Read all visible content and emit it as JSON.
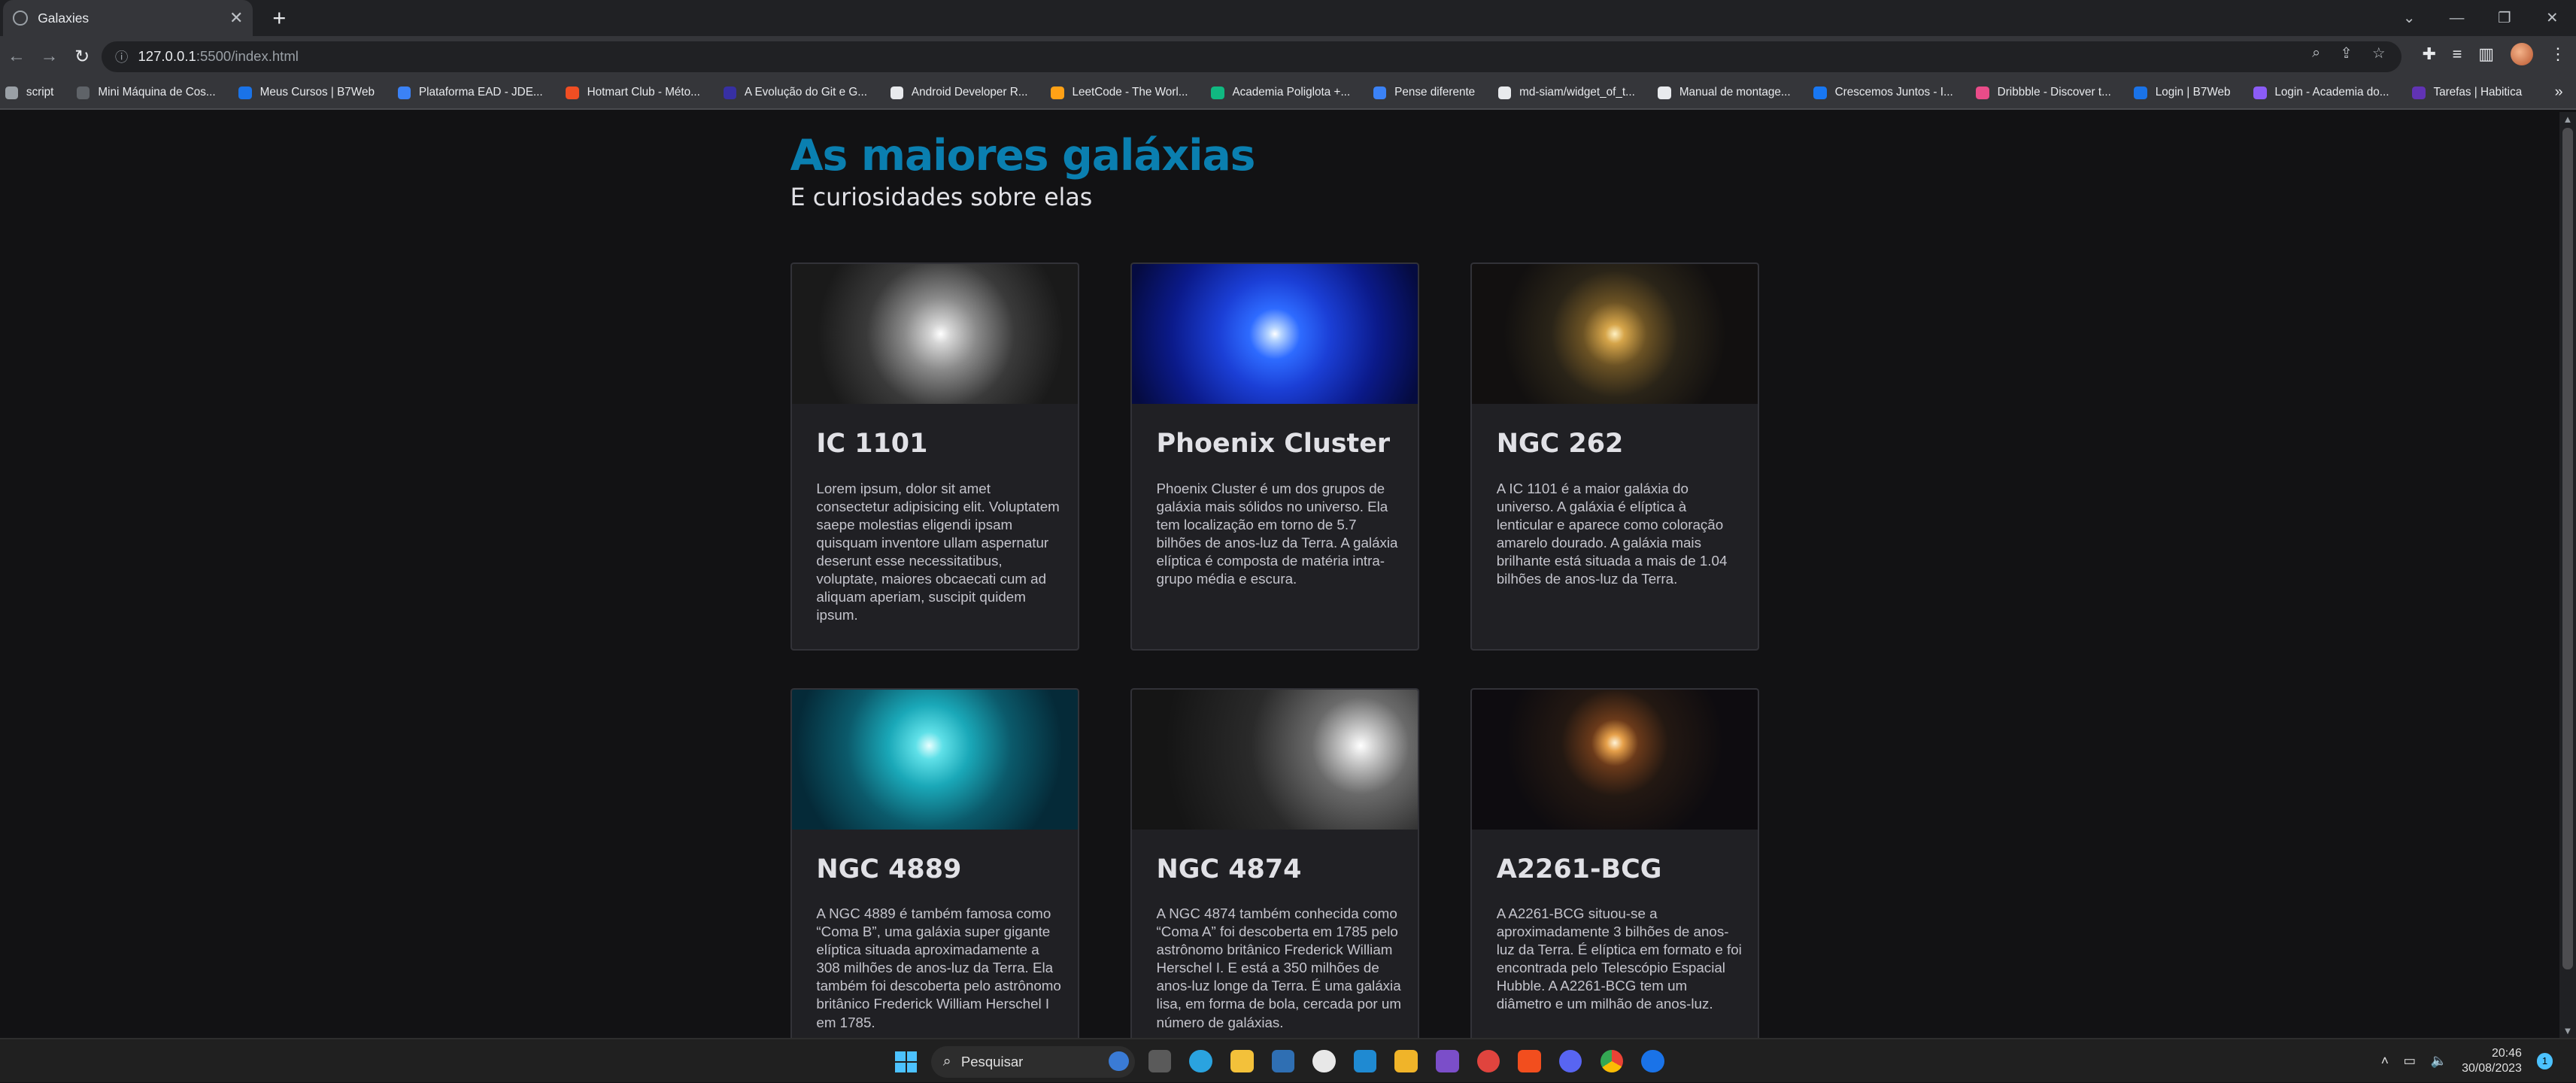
{
  "browser": {
    "tab_title": "Galaxies",
    "new_tab_symbol": "+",
    "url_host": "127.0.0.1",
    "url_path": ":5500/index.html",
    "bookmarks": [
      {
        "label": "script",
        "color": "#9aa0a6"
      },
      {
        "label": "Mini Máquina de Cos...",
        "color": "#5f6368"
      },
      {
        "label": "Meus Cursos | B7Web",
        "color": "#1a73e8"
      },
      {
        "label": "Plataforma EAD - JDE...",
        "color": "#3b82f6"
      },
      {
        "label": "Hotmart Club - Méto...",
        "color": "#f04e23"
      },
      {
        "label": "A Evolução do Git e G...",
        "color": "#3730a3"
      },
      {
        "label": "Android Developer R...",
        "color": "#e8eaed"
      },
      {
        "label": "LeetCode - The Worl...",
        "color": "#ffa116"
      },
      {
        "label": "Academia Poliglota +...",
        "color": "#10b981"
      },
      {
        "label": "Pense diferente",
        "color": "#3b82f6"
      },
      {
        "label": "md-siam/widget_of_t...",
        "color": "#e8eaed"
      },
      {
        "label": "Manual de montage...",
        "color": "#e8eaed"
      },
      {
        "label": "Crescemos Juntos - I...",
        "color": "#1877f2"
      },
      {
        "label": "Dribbble - Discover t...",
        "color": "#ea4c89"
      },
      {
        "label": "Login | B7Web",
        "color": "#1a73e8"
      },
      {
        "label": "Login - Academia do...",
        "color": "#8b5cf6"
      },
      {
        "label": "Tarefas | Habitica",
        "color": "#6133b4"
      }
    ]
  },
  "page": {
    "title": "As maiores galáxias",
    "subtitle": "E curiosidades sobre elas",
    "cards": [
      {
        "name": "IC 1101",
        "text": "Lorem ipsum, dolor sit amet consectetur adipisicing elit. Voluptatem saepe molestias eligendi ipsam quisquam inventore ullam aspernatur deserunt esse necessitatibus, voluptate, maiores obcaecati cum ad aliquam aperiam, suscipit quidem ipsum."
      },
      {
        "name": "Phoenix Cluster",
        "text": "Phoenix Cluster é um dos grupos de galáxia mais sólidos no universo. Ela tem localização em torno de 5.7 bilhões de anos-luz da Terra. A galáxia elíptica é composta de matéria intra-grupo média e escura."
      },
      {
        "name": "NGC 262",
        "text": "A IC 1101 é a maior galáxia do universo. A galáxia é elíptica à lenticular e aparece como coloração amarelo dourado. A galáxia mais brilhante está situada a mais de 1.04 bilhões de anos-luz da Terra."
      },
      {
        "name": "NGC 4889",
        "text": "A NGC 4889 é também famosa como “Coma B”, uma galáxia super gigante elíptica situada aproximadamente a 308 milhões de anos-luz da Terra. Ela também foi descoberta pelo astrônomo britânico Frederick William Herschel I em 1785."
      },
      {
        "name": "NGC 4874",
        "text": "A NGC 4874 também conhecida como “Coma A” foi descoberta em 1785 pelo astrônomo britânico Frederick William Herschel I. E está a 350 milhões de anos-luz longe da Terra. É uma galáxia lisa, em forma de bola, cercada por um número de galáxias."
      },
      {
        "name": "A2261-BCG",
        "text": "A A2261-BCG situou-se a aproximadamente 3 bilhões de anos-luz da Terra. É elíptica em formato e foi encontrada pelo Telescópio Espacial Hubble. A A2261-BCG tem um diâmetro e um milhão de anos-luz."
      }
    ]
  },
  "taskbar": {
    "search_placeholder": "Pesquisar",
    "time": "20:46",
    "date": "30/08/2023",
    "notification_count": "1"
  }
}
